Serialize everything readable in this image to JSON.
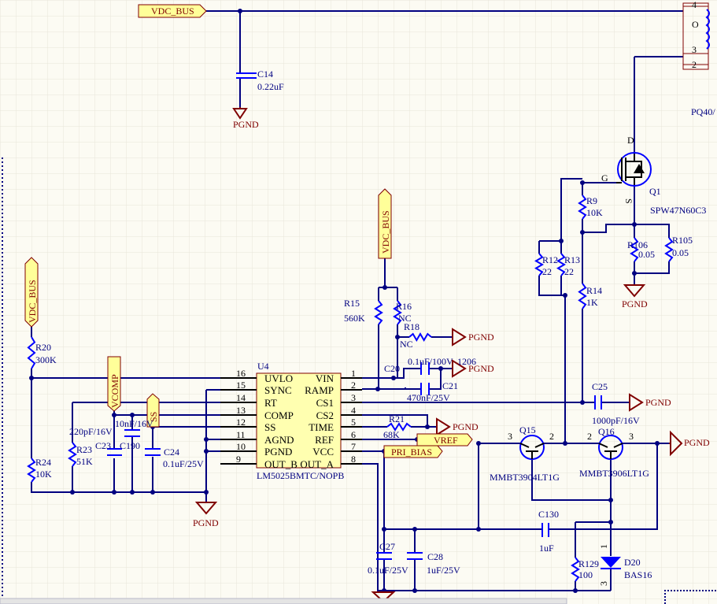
{
  "colors": {
    "wire": "#000080",
    "component": "#0000ff",
    "power": "#800000",
    "port_fill": "#ffff99",
    "background": "#fcfbf3"
  },
  "ports": {
    "vdc_bus_top": "VDC_BUS",
    "vdc_bus_mid": "VDC_BUS",
    "vdc_bus_left": "VDC_BUS",
    "vcomp": "VCOMP",
    "ss": "SS",
    "vref": "VREF",
    "pri_bias": "PRI_BIAS"
  },
  "power": {
    "pgnd": "PGND"
  },
  "u4": {
    "ref": "U4",
    "part": "LM5025BMTC/NOPB",
    "left_pins": [
      {
        "num": "16",
        "name": "UVLO"
      },
      {
        "num": "15",
        "name": "SYNC"
      },
      {
        "num": "14",
        "name": "RT"
      },
      {
        "num": "13",
        "name": "COMP"
      },
      {
        "num": "12",
        "name": "SS"
      },
      {
        "num": "11",
        "name": "AGND"
      },
      {
        "num": "10",
        "name": "PGND"
      },
      {
        "num": "9",
        "name": "OUT_B"
      }
    ],
    "right_pins": [
      {
        "num": "1",
        "name": "VIN"
      },
      {
        "num": "2",
        "name": "RAMP"
      },
      {
        "num": "3",
        "name": "CS1"
      },
      {
        "num": "4",
        "name": "CS2"
      },
      {
        "num": "5",
        "name": "TIME"
      },
      {
        "num": "6",
        "name": "REF"
      },
      {
        "num": "7",
        "name": "VCC"
      },
      {
        "num": "8",
        "name": "OUT_A"
      }
    ]
  },
  "c14": {
    "ref": "C14",
    "value": "0.22uF"
  },
  "transformer": {
    "ref": "PQ40/",
    "pins": [
      "4",
      "3",
      "2"
    ],
    "marker": "O"
  },
  "q1": {
    "ref": "Q1",
    "part": "SPW47N60C3",
    "d": "D",
    "g": "G",
    "s": "S"
  },
  "r9": {
    "ref": "R9",
    "value": "10K"
  },
  "r12": {
    "ref": "R12",
    "value": "22"
  },
  "r13": {
    "ref": "R13",
    "value": "22"
  },
  "r14": {
    "ref": "R14",
    "value": "1K"
  },
  "r105": {
    "ref": "R105",
    "value": "0.05"
  },
  "r106": {
    "ref": "R106",
    "value": "0.05"
  },
  "r15": {
    "ref": "R15",
    "value": "560K"
  },
  "r16": {
    "ref": "R16",
    "value": "NC"
  },
  "r18": {
    "ref": "R18",
    "value": "NC"
  },
  "c20": {
    "ref": "C20",
    "value": "0.1uF/100V",
    "package": "1206"
  },
  "c21": {
    "ref": "C21",
    "value": "470nF/25V"
  },
  "r20": {
    "ref": "R20",
    "value": "300K"
  },
  "r24": {
    "ref": "R24",
    "value": "10K"
  },
  "r23": {
    "ref": "R23",
    "value": "51K"
  },
  "c23": {
    "ref": "C23",
    "value": "220pF/16V"
  },
  "c190": {
    "ref": "C190",
    "value": "10nF/16V"
  },
  "c24": {
    "ref": "C24",
    "value": "0.1uF/25V"
  },
  "r21": {
    "ref": "R21",
    "value": "68K"
  },
  "c25": {
    "ref": "C25",
    "value": "1000pF/16V"
  },
  "q15": {
    "ref": "Q15",
    "part": "MMBT3904LT1G",
    "pin_left": "3",
    "pin_right": "2"
  },
  "q16": {
    "ref": "Q16",
    "part": "MMBT3906LT1G",
    "pin_left": "2",
    "pin_right": "3"
  },
  "c130": {
    "ref": "C130",
    "value": "1uF"
  },
  "c27": {
    "ref": "C27",
    "value": "0.1uF/25V"
  },
  "c28": {
    "ref": "C28",
    "value": "1uF/25V"
  },
  "r129": {
    "ref": "R129",
    "value": "100"
  },
  "d20": {
    "ref": "D20",
    "part": "BAS16",
    "pin_top": "1",
    "pin_bottom": "3"
  }
}
